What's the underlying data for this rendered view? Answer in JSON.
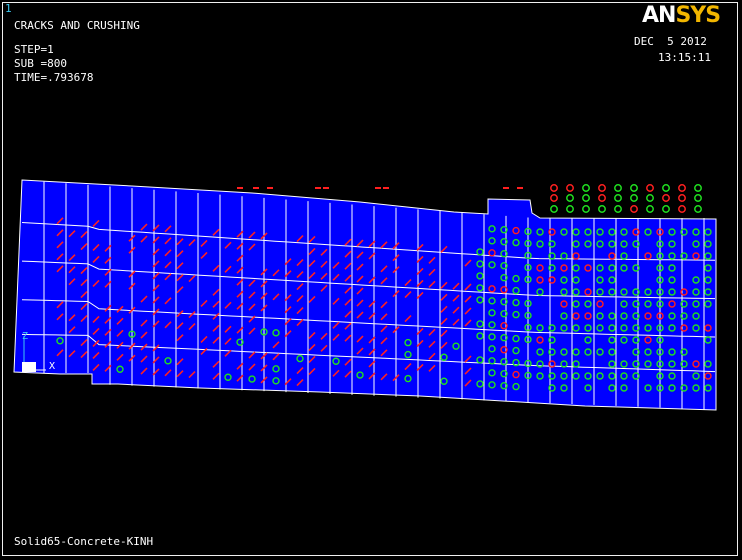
{
  "window": {
    "number": "1"
  },
  "plot": {
    "title": "CRACKS AND CRUSHING",
    "step": "STEP=1",
    "sub": "SUB =800",
    "time": "TIME=.793678",
    "date": "DEC  5 2012",
    "clock": "13:15:11",
    "footer": "Solid65-Concrete-KINH"
  },
  "logo": {
    "part1": "AN",
    "part2": "SYS"
  },
  "triad": {
    "z": "Z",
    "x": "X"
  },
  "colors": {
    "background": "#000000",
    "mesh_fill": "#0000ff",
    "mesh_lines": "#ffffff",
    "crack": "#ff2020",
    "crush": "#20e020",
    "logo_accent": "#f2b600",
    "window_number": "#3ec8f0"
  }
}
